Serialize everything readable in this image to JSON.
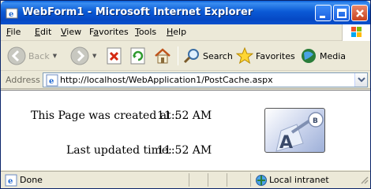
{
  "window": {
    "title": "WebForm1 - Microsoft Internet Explorer"
  },
  "menu": {
    "items": [
      {
        "label": "File",
        "key": "F",
        "rest": "ile"
      },
      {
        "label": "Edit",
        "key": "E",
        "rest": "dit"
      },
      {
        "label": "View",
        "key": "V",
        "rest": "iew"
      },
      {
        "label": "Favorites",
        "key": "a",
        "pre": "F",
        "rest": "vorites"
      },
      {
        "label": "Tools",
        "key": "T",
        "rest": "ools"
      },
      {
        "label": "Help",
        "key": "H",
        "rest": "elp"
      }
    ]
  },
  "toolbar": {
    "back": "Back",
    "search": "Search",
    "favorites": "Favorites",
    "media": "Media"
  },
  "address": {
    "label": "Address",
    "url": "http://localhost/WebApplication1/PostCache.aspx"
  },
  "content": {
    "created_label": "This Page was created at :",
    "created_time": "11:52 AM",
    "updated_label": "Last updated time:",
    "updated_time": "11:52 AM"
  },
  "status": {
    "text": "Done",
    "zone": "Local intranet"
  },
  "colors": {
    "titlebar": "#0a5fdc",
    "chrome": "#ece9d8",
    "content_bg": "#ffffff"
  }
}
